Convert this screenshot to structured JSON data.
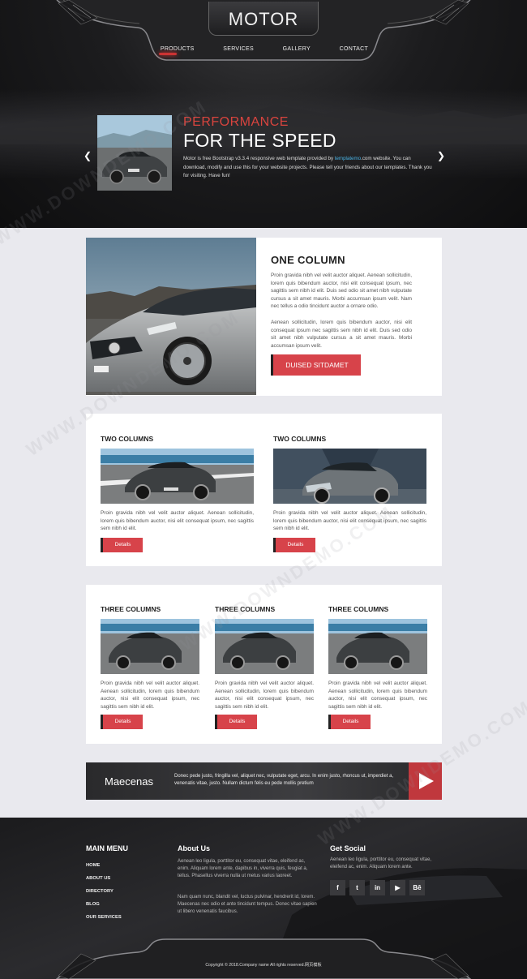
{
  "header": {
    "logo": "MOTOR",
    "nav": [
      {
        "label": "PRODUCTS"
      },
      {
        "label": "SERVICES"
      },
      {
        "label": "GALLERY"
      },
      {
        "label": "CONTACT"
      }
    ]
  },
  "slider": {
    "title1": "PERFORMANCE",
    "title2": "FOR THE SPEED",
    "text_before": "Motor is free Bootstrap v3.3.4 responsive web template provided by ",
    "link": "templatemo",
    "text_after": ".com website. You can download, modify and use this for your website projects. Please tell your friends about our templates. Thank you for visiting. Have fun!",
    "prev_icon": "chevron-left-icon",
    "next_icon": "chevron-right-icon"
  },
  "one_column": {
    "heading": "ONE COLUMN",
    "p1": "Proin gravida nibh vel velit auctor aliquet. Aenean sollicitudin, lorem quis bibendum auctor, nisi elit consequat ipsum, nec sagittis sem nibh id elit. Duis sed odio sit amet nibh vulputate cursus a sit amet mauris. Morbi accumsan ipsum velit. Nam nec tellus a odio tincidunt auctor a ornare odio.",
    "p2": "Aenean sollicitudin, lorem quis bibendum auctor, nisi elit consequat ipsum nec sagittis sem nibh id elit. Duis sed odio sit amet nibh vulputate cursus a sit amet mauris. Morbi accumsan ipsum velit.",
    "button": "DUISED SITDAMET"
  },
  "two_columns": {
    "col1_heading": "TWO COLUMNS",
    "col2_heading": "TWO COLUMNS",
    "text": "Proin gravida nibh vel velit auctor aliquet. Aenean sollicitudin, lorem quis bibendum auctor, nisi elit consequat ipsum, nec sagittis sem nibh id elit.",
    "button": "Details"
  },
  "three_columns": {
    "heading": "THREE COLUMNS",
    "text": "Proin gravida nibh vel velit auctor aliquet. Aenean sollicitudin, lorem quis bibendum auctor, nisi elit consequat ipsum, nec sagittis sem nibh id elit.",
    "button": "Details"
  },
  "banner": {
    "title": "Maecenas",
    "text": "Donec pede justo, fringilla vel, aliquet nec, vulputate eget, arcu. In enim justo, rhoncus ut, imperdiet a, venenatis vitae, justo. Nullam dictum felis eu pede mollis pretium",
    "play_icon": "play-icon",
    "accent": "#c0383d"
  },
  "footer": {
    "menu_heading": "MAIN MENU",
    "menu": [
      "HOME",
      "ABOUT US",
      "DIRECTORY",
      "BLOG",
      "OUR SERVICES"
    ],
    "about_heading": "About Us",
    "about_p1": "Aenean leo ligula, porttitor eu, consequat vitae, eleifend ac, enim. Aliquam lorem ante, dapibus in, viverra quis, feugiat a, tellus. Phasellus viverra nulla ut metus varius laoreet.",
    "about_p2": "Nam quam nunc, blandit vel, luctus pulvinar, hendrerit id, lorem. Maecenas nec odio et ante tincidunt tempus. Donec vitae sapien ut libero venenatis faucibus.",
    "social_heading": "Get Social",
    "social_text": "Aenean leo ligula, porttitor eu, consequat vitae, eleifend ac, enim. Aliquam lorem ante.",
    "social_icons": [
      {
        "icon": "facebook-icon",
        "glyph": "f"
      },
      {
        "icon": "twitter-icon",
        "glyph": "t"
      },
      {
        "icon": "linkedin-icon",
        "glyph": "in"
      },
      {
        "icon": "youtube-icon",
        "glyph": "▶"
      },
      {
        "icon": "behance-icon",
        "glyph": "Bē"
      }
    ],
    "copyright": "Copyright © 2018.Company name All rights reserved.网页模板"
  },
  "watermark": "WWW.DOWNDEMO.COM",
  "colors": {
    "accent_red": "#d7434a",
    "dark": "#1c1c1e",
    "page_bg": "#e9e9ee"
  }
}
